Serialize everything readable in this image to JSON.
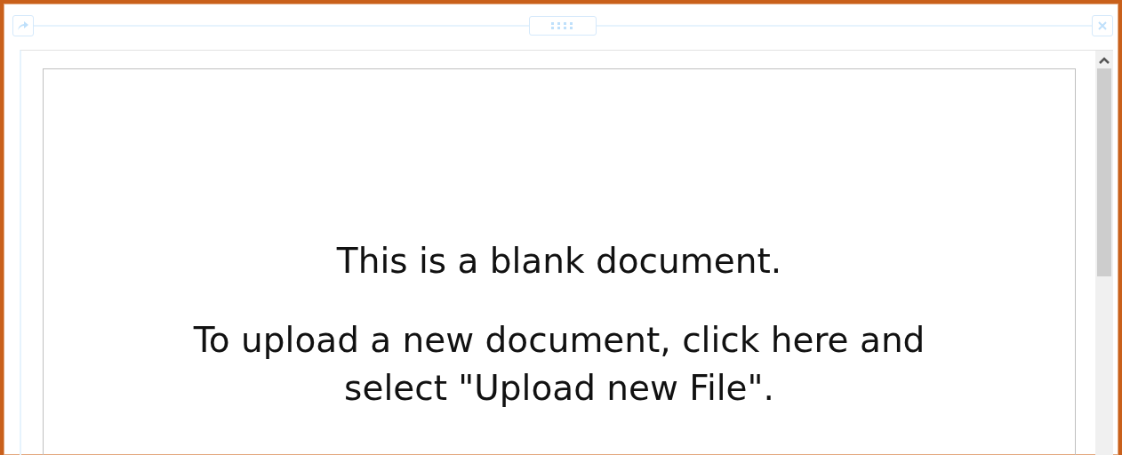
{
  "document": {
    "heading": "This is a blank document.",
    "instructions": "To upload a new document, click here and select \"Upload new File\"."
  }
}
